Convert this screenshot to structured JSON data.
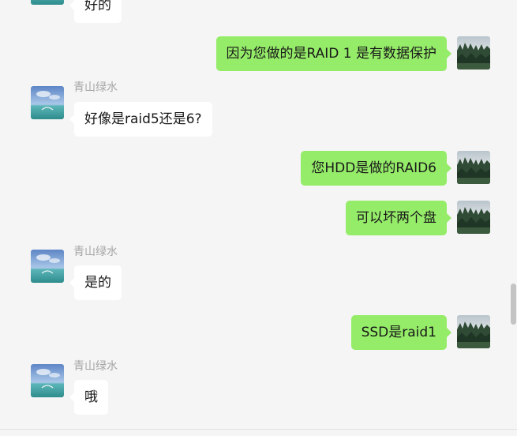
{
  "messages": [
    {
      "sender": "peer",
      "text": "好的"
    },
    {
      "sender": "self",
      "text": "因为您做的是RAID 1  是有数据保护"
    },
    {
      "sender": "peer",
      "name": "青山绿水",
      "text": "好像是raid5还是6?"
    },
    {
      "sender": "self",
      "text": "您HDD是做的RAID6"
    },
    {
      "sender": "self",
      "text": "可以坏两个盘"
    },
    {
      "sender": "peer",
      "name": "青山绿水",
      "text": "是的"
    },
    {
      "sender": "self",
      "text": "SSD是raid1"
    },
    {
      "sender": "peer",
      "name": "青山绿水",
      "text": "哦"
    }
  ],
  "colors": {
    "background": "#f5f5f5",
    "self_bubble": "#95ec69",
    "peer_bubble": "#ffffff",
    "nickname": "#a5a5a5"
  },
  "icons": {
    "self_avatar": "forest-landscape-avatar",
    "peer_avatar": "sea-sky-avatar"
  }
}
